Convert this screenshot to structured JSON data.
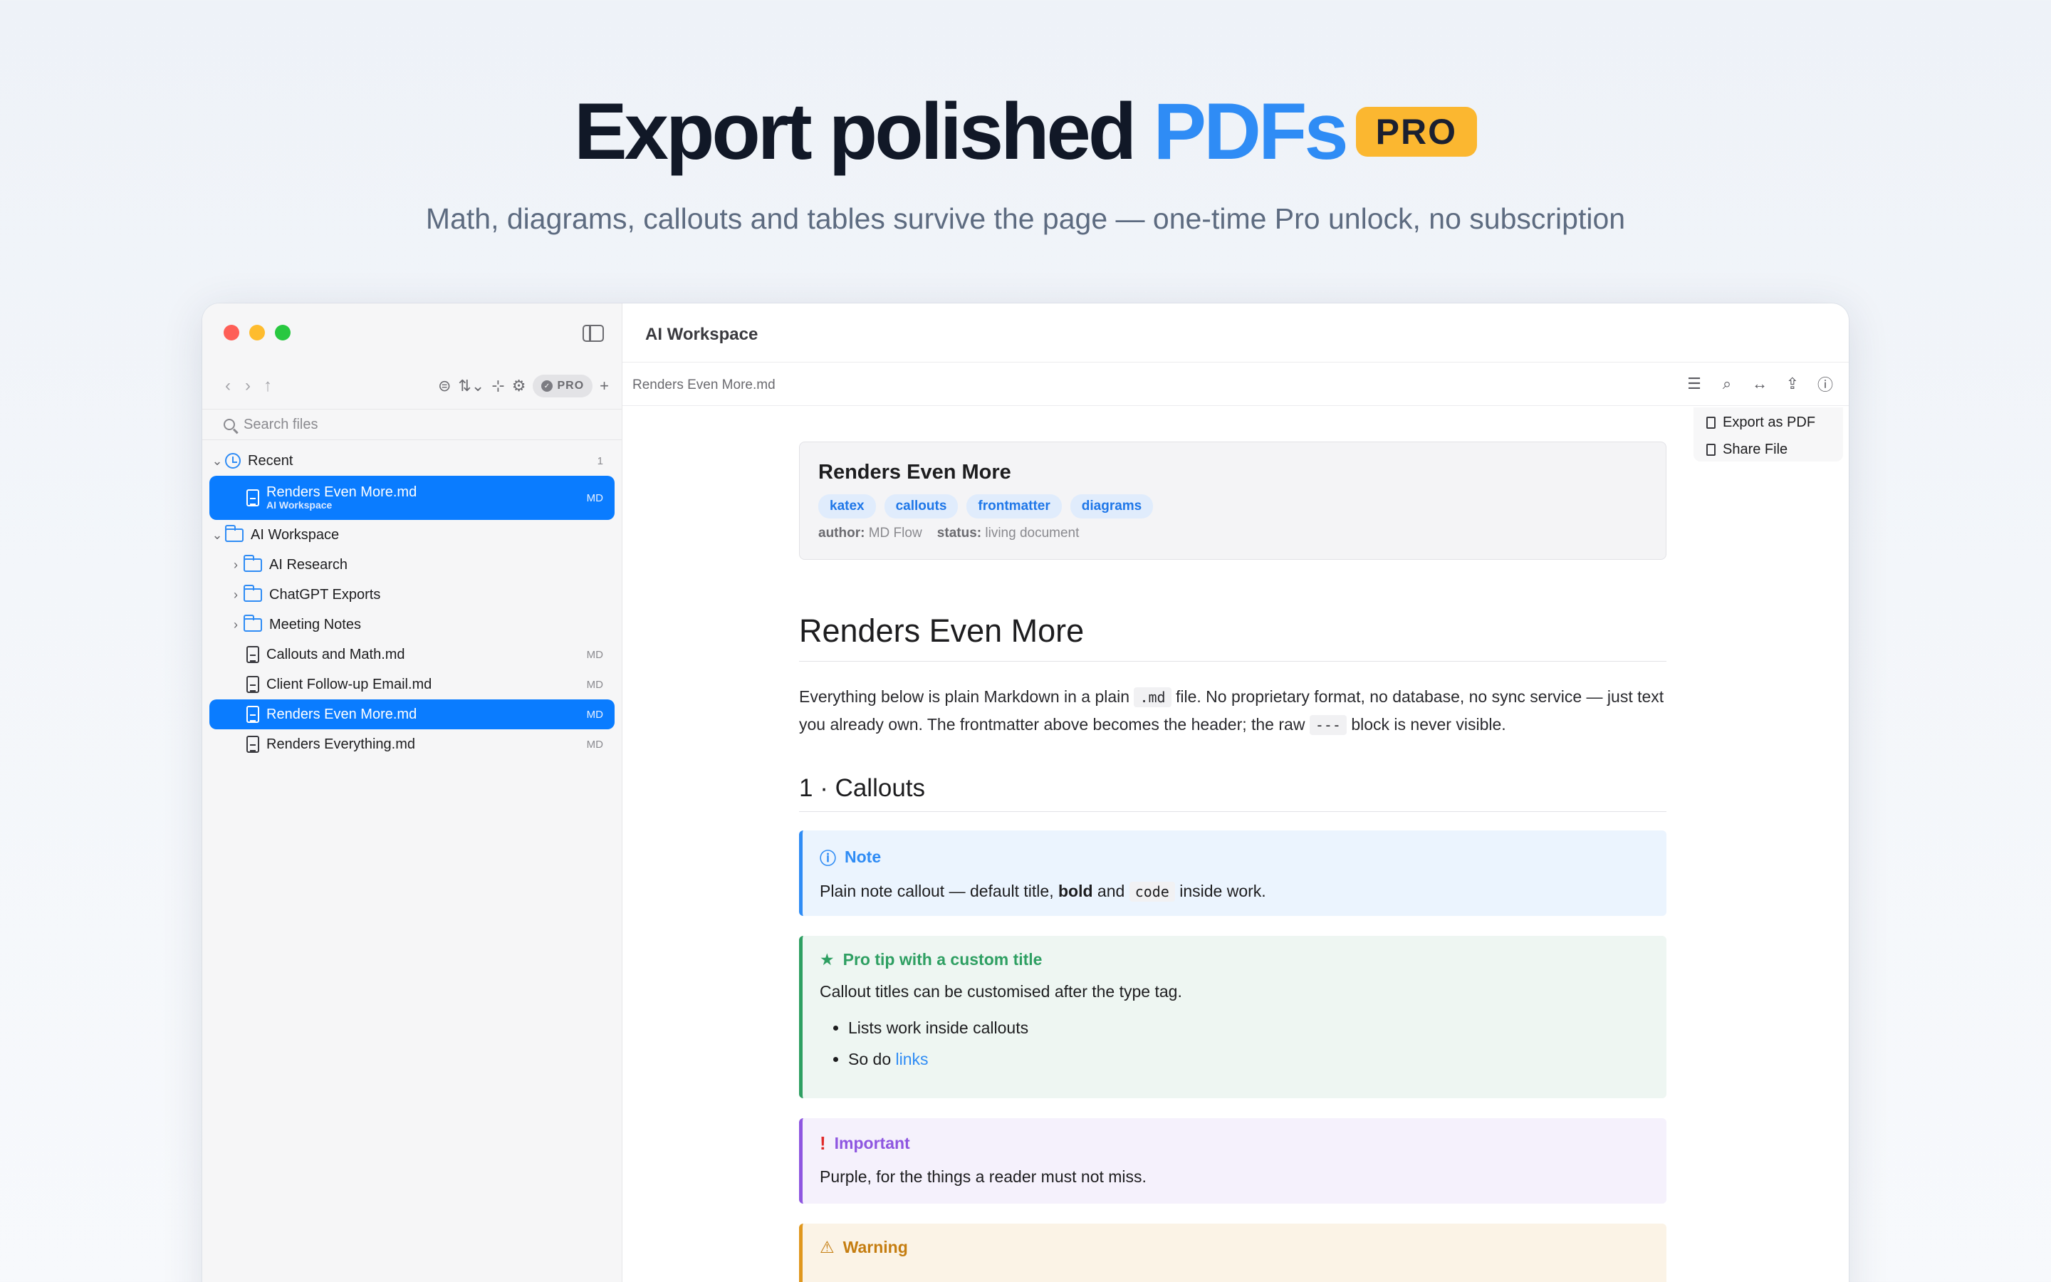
{
  "hero": {
    "title_main": "Export polished ",
    "title_accent": "PDFs",
    "badge": "PRO",
    "subtitle": "Math, diagrams, callouts and tables survive the page — one-time Pro unlock, no subscription"
  },
  "window": {
    "title": "AI Workspace",
    "breadcrumb": "Renders Even More.md"
  },
  "sidebar": {
    "pro_label": "PRO",
    "search_placeholder": "Search files",
    "recent": {
      "label": "Recent",
      "count": "1"
    },
    "recent_item": {
      "name": "Renders Even More.md",
      "location": "AI Workspace",
      "tag": "MD"
    },
    "workspace": {
      "label": "AI Workspace"
    },
    "folders": [
      "AI Research",
      "ChatGPT Exports",
      "Meeting Notes"
    ],
    "files": [
      {
        "name": "Callouts and Math.md",
        "tag": "MD"
      },
      {
        "name": "Client Follow-up Email.md",
        "tag": "MD"
      },
      {
        "name": "Renders Even More.md",
        "tag": "MD"
      },
      {
        "name": "Renders Everything.md",
        "tag": "MD"
      }
    ]
  },
  "menu": {
    "export_pdf": "Export as PDF",
    "share_file": "Share File"
  },
  "document": {
    "frontmatter": {
      "title": "Renders Even More",
      "tags": [
        "katex",
        "callouts",
        "frontmatter",
        "diagrams"
      ],
      "author_key": "author:",
      "author_val": "MD Flow",
      "status_key": "status:",
      "status_val": "living document"
    },
    "heading": "Renders Even More",
    "para_1": "Everything below is plain Markdown in a plain ",
    "para_code1": ".md",
    "para_2": " file. No proprietary format, no database, no sync service — just text you already own. The frontmatter above becomes the header; the raw ",
    "para_code2": "---",
    "para_3": " block is never visible.",
    "section": "1 · Callouts",
    "note": {
      "title": "Note",
      "body_1": "Plain note callout — default title, ",
      "body_bold": "bold",
      "body_2": " and ",
      "body_code": "code",
      "body_3": " inside work."
    },
    "tip": {
      "title": "Pro tip with a custom title",
      "body": "Callout titles can be customised after the type tag.",
      "item_1": "Lists work inside callouts",
      "item_2_prefix": "So do ",
      "item_2_link": "links"
    },
    "important": {
      "title": "Important",
      "body": "Purple, for the things a reader must not miss."
    },
    "warning": {
      "title": "Warning"
    }
  },
  "colors": {
    "accent": "#2f8cf5",
    "selection": "#0a7cff",
    "badge": "#fbb730"
  }
}
